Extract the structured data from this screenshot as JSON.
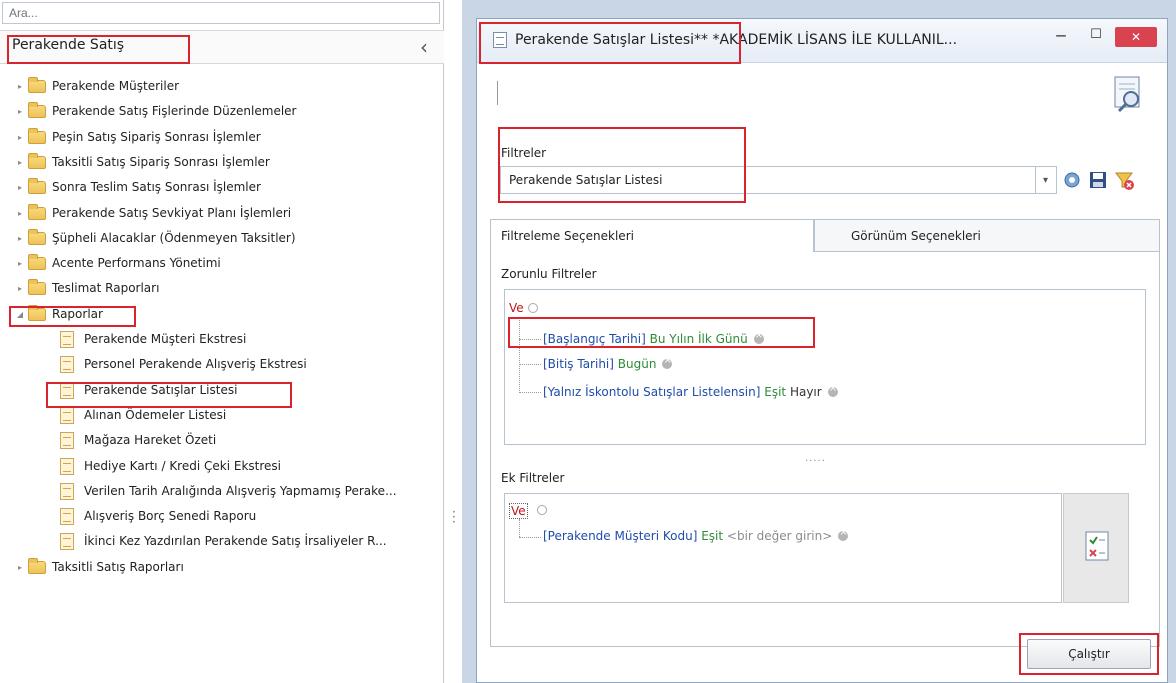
{
  "search": {
    "placeholder": "Ara..."
  },
  "nav": {
    "title": "Perakende Satış",
    "collapse_icon": "chevron-left-icon",
    "items": [
      {
        "label": "Perakende Müşteriler",
        "type": "folder"
      },
      {
        "label": "Perakende Satış Fişlerinde Düzenlemeler",
        "type": "folder"
      },
      {
        "label": "Peşin Satış Sipariş Sonrası İşlemler",
        "type": "folder"
      },
      {
        "label": "Taksitli Satış Sipariş Sonrası İşlemler",
        "type": "folder"
      },
      {
        "label": "Sonra Teslim Satış Sonrası İşlemler",
        "type": "folder"
      },
      {
        "label": "Perakende Satış Sevkiyat Planı İşlemleri",
        "type": "folder"
      },
      {
        "label": "Şüpheli Alacaklar (Ödenmeyen Taksitler)",
        "type": "folder"
      },
      {
        "label": "Acente Performans Yönetimi",
        "type": "folder"
      },
      {
        "label": "Teslimat Raporları",
        "type": "folder"
      },
      {
        "label": "Raporlar",
        "type": "folder-open"
      },
      {
        "label": "Perakende Müşteri Ekstresi",
        "type": "report"
      },
      {
        "label": "Personel Perakende Alışveriş Ekstresi",
        "type": "report"
      },
      {
        "label": "Perakende Satışlar Listesi",
        "type": "report"
      },
      {
        "label": "Alınan Ödemeler Listesi",
        "type": "report"
      },
      {
        "label": "Mağaza Hareket Özeti",
        "type": "report"
      },
      {
        "label": "Hediye Kartı / Kredi Çeki Ekstresi",
        "type": "report"
      },
      {
        "label": "Verilen Tarih Aralığında Alışveriş Yapmamış Perake...",
        "type": "report"
      },
      {
        "label": "Alışveriş Borç Senedi Raporu",
        "type": "report"
      },
      {
        "label": "İkinci Kez Yazdırılan Perakende Satış İrsaliyeler R...",
        "type": "report"
      },
      {
        "label": "Taksitli Satış Raporları",
        "type": "folder"
      }
    ]
  },
  "window": {
    "title": "Perakende Satışlar Listesi**",
    "title_suffix": " *AKADEMİK LİSANS İLE KULLANIL...",
    "minimize": "‒",
    "maximize": "☐",
    "close": "✕"
  },
  "filters": {
    "label": "Filtreler",
    "selected": "Perakende Satışlar Listesi",
    "dropdown_icon": "chevron-down-icon"
  },
  "tabs": [
    {
      "label": "Filtreleme Seçenekleri",
      "active": true
    },
    {
      "label": "Görünüm Seçenekleri",
      "active": false
    }
  ],
  "required_filters": {
    "label": "Zorunlu Filtreler",
    "operator": "Ve",
    "rows": [
      {
        "field": "[Başlangıç Tarihi]",
        "op": "Bu Yılın İlk Günü",
        "value": ""
      },
      {
        "field": "[Bitiş Tarihi]",
        "op": "Bugün",
        "value": ""
      },
      {
        "field": "[Yalnız İskontolu Satışlar Listelensin]",
        "op": "Eşit",
        "value": "Hayır"
      }
    ]
  },
  "extra_filters": {
    "label": "Ek Filtreler",
    "operator": "Ve",
    "rows": [
      {
        "field": "[Perakende Müşteri Kodu]",
        "op": "Eşit",
        "value": "<bir değer girin>"
      }
    ]
  },
  "splitter_dots": ".....",
  "run_button": "Çalıştır",
  "colors": {
    "highlight": "#d9232d",
    "operator": "#c0141c",
    "field": "#1f4da8",
    "op": "#2e8b36",
    "close": "#d9434f"
  }
}
